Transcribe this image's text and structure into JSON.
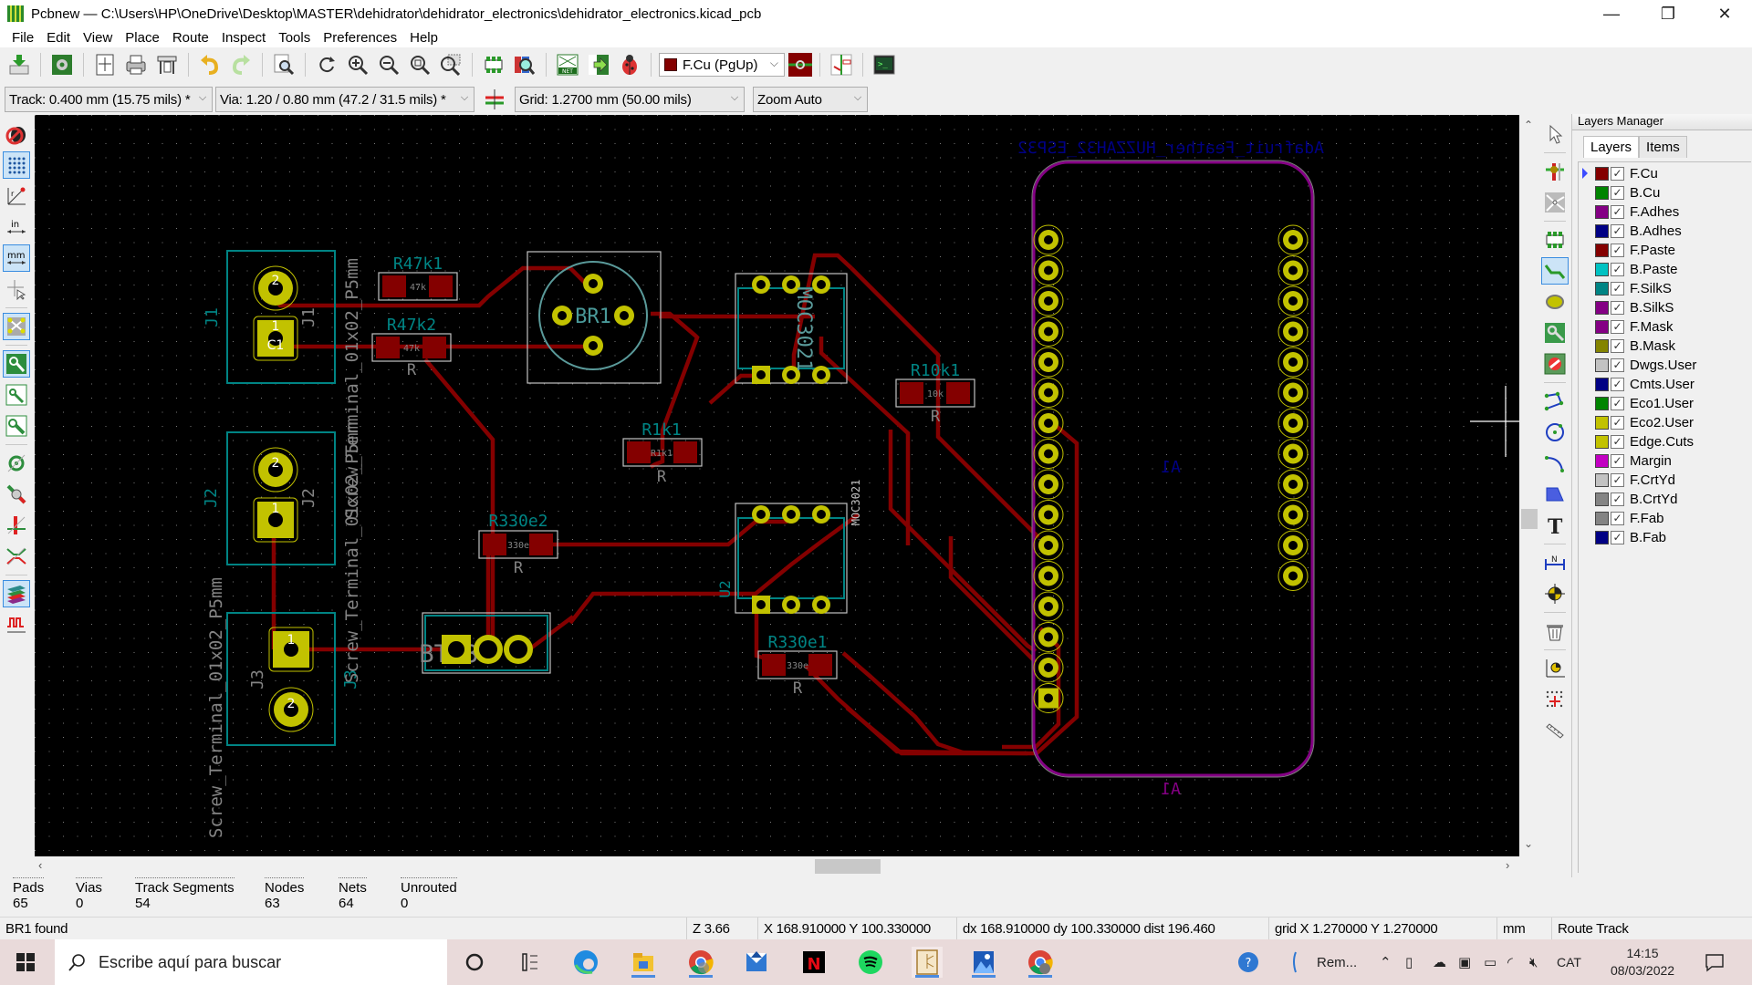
{
  "window": {
    "title": "Pcbnew — C:\\Users\\HP\\OneDrive\\Desktop\\MASTER\\dehidrator\\dehidrator_electronics\\dehidrator_electronics.kicad_pcb",
    "minimize": "—",
    "maximize": "❐",
    "close": "✕"
  },
  "menu": [
    "File",
    "Edit",
    "View",
    "Place",
    "Route",
    "Inspect",
    "Tools",
    "Preferences",
    "Help"
  ],
  "toolbar": {
    "icons": [
      "save-board-icon",
      "board-setup-icon",
      "page-settings-icon",
      "print-icon",
      "plot-icon",
      "undo-icon",
      "redo-icon",
      "find-icon",
      "redraw-icon",
      "zoom-in-icon",
      "zoom-out-icon",
      "zoom-fit-icon",
      "zoom-selection-icon",
      "footprint-editor-icon",
      "footprint-viewer-icon",
      "netlist-icon",
      "update-pcb-icon",
      "drc-icon"
    ],
    "layer_select": "F.Cu (PgUp)",
    "layer_color": "#840000"
  },
  "toolbar2": {
    "track": "Track: 0.400 mm (15.75 mils) *",
    "via": "Via: 1.20 / 0.80 mm (47.2 / 31.5 mils) *",
    "grid": "Grid: 1.2700 mm (50.00 mils)",
    "zoom": "Zoom Auto"
  },
  "left_toolbar": [
    "drc-off-icon",
    "grid-icon",
    "polar-coords-icon",
    "inch-units-icon",
    "mm-units-icon",
    "cursor-shape-icon",
    "ratsnest-icon",
    "show-zones-icon",
    "zone-outline-icon",
    "zone-fill-icon",
    "pad-sketch-icon",
    "via-sketch-icon",
    "track-sketch-icon",
    "microwave-icon",
    "high-contrast-icon",
    "length-tuning-icon"
  ],
  "right_toolbar": [
    "select-icon",
    "highlight-net-icon",
    "local-ratsnest-icon",
    "add-footprint-icon",
    "route-track-icon",
    "add-via-icon",
    "add-zone-icon",
    "keepout-icon",
    "add-line-icon",
    "add-circle-icon",
    "add-arc-icon",
    "add-polygon-icon",
    "add-text-icon",
    "add-dimension-icon",
    "add-target-icon",
    "delete-icon",
    "set-origin-icon",
    "grid-origin-icon",
    "measure-icon"
  ],
  "layers_manager": {
    "title": "Layers Manager",
    "tabs": [
      "Layers",
      "Items"
    ],
    "layers": [
      {
        "name": "F.Cu",
        "color": "#840000",
        "checked": true,
        "active": true
      },
      {
        "name": "B.Cu",
        "color": "#008400",
        "checked": true
      },
      {
        "name": "F.Adhes",
        "color": "#840084",
        "checked": true
      },
      {
        "name": "B.Adhes",
        "color": "#000084",
        "checked": true
      },
      {
        "name": "F.Paste",
        "color": "#840000",
        "checked": true
      },
      {
        "name": "B.Paste",
        "color": "#00c2c2",
        "checked": true
      },
      {
        "name": "F.SilkS",
        "color": "#008484",
        "checked": true
      },
      {
        "name": "B.SilkS",
        "color": "#840084",
        "checked": true
      },
      {
        "name": "F.Mask",
        "color": "#840084",
        "checked": true
      },
      {
        "name": "B.Mask",
        "color": "#848400",
        "checked": true
      },
      {
        "name": "Dwgs.User",
        "color": "#c2c2c2",
        "checked": true
      },
      {
        "name": "Cmts.User",
        "color": "#000084",
        "checked": true
      },
      {
        "name": "Eco1.User",
        "color": "#008400",
        "checked": true
      },
      {
        "name": "Eco2.User",
        "color": "#c2c200",
        "checked": true
      },
      {
        "name": "Edge.Cuts",
        "color": "#c2c200",
        "checked": true
      },
      {
        "name": "Margin",
        "color": "#c200c2",
        "checked": true
      },
      {
        "name": "F.CrtYd",
        "color": "#c2c2c2",
        "checked": true
      },
      {
        "name": "B.CrtYd",
        "color": "#848484",
        "checked": true
      },
      {
        "name": "F.Fab",
        "color": "#848484",
        "checked": true
      },
      {
        "name": "B.Fab",
        "color": "#000084",
        "checked": true
      }
    ]
  },
  "board": {
    "labels": {
      "esp32_name": "Adafruit_Feather_HUZZAH32_ESP32",
      "a1": "A1",
      "j1": "J1",
      "j2": "J2",
      "j3": "J3",
      "screw1": "Screw_Terminal_01x02_P5mm",
      "screw2": "Screw_Terminal_01x02_P5mm",
      "screw3": "Screw_Terminal_01x02_P5mm",
      "r47k1": "R47k1",
      "r47k2": "R47k2",
      "r1k1": "R1k1",
      "r10k1": "R10k1",
      "r330e1": "R330e1",
      "r330e2": "R330e2",
      "r": "R",
      "v47k": "47k",
      "v1k": "R1k1",
      "v10k": "10k",
      "v330": "330e",
      "moc3021": "MOC3021",
      "moc_flip": "MOC3021",
      "bt136": "BT136",
      "bt136_val": "BT136",
      "br1": "BR1",
      "u2": "U2",
      "c1": "C1",
      "pin1": "1",
      "pin2": "2"
    },
    "colors": {
      "background": "#000000",
      "track": "#840000",
      "pad": "#c2c200",
      "silk_front": "#008484",
      "fab": "#c2c2c2",
      "esp_text": "#000084",
      "margin": "#840084"
    }
  },
  "messages": {
    "stats": [
      {
        "label": "Pads",
        "value": "65"
      },
      {
        "label": "Vias",
        "value": "0"
      },
      {
        "label": "Track Segments",
        "value": "54"
      },
      {
        "label": "Nodes",
        "value": "63"
      },
      {
        "label": "Nets",
        "value": "64"
      },
      {
        "label": "Unrouted",
        "value": "0"
      }
    ]
  },
  "status": {
    "message": "BR1 found",
    "zoom": "Z 3.66",
    "coords": "X 168.910000  Y 100.330000",
    "delta": "dx 168.910000  dy 100.330000  dist 196.460",
    "grid": "grid X 1.270000  Y 1.270000",
    "units": "mm",
    "mode": "Route Track"
  },
  "taskbar": {
    "search_placeholder": "Escribe aquí para buscar",
    "apps": [
      "cortana-icon",
      "task-view-icon",
      "edge-icon",
      "file-explorer-icon",
      "chrome-icon",
      "mail-icon",
      "netflix-icon",
      "spotify-icon",
      "kicad-icon",
      "photos-icon",
      "chrome-profile-icon"
    ],
    "tray_label": "Rem...",
    "language": "CAT",
    "time": "14:15",
    "date": "08/03/2022"
  }
}
